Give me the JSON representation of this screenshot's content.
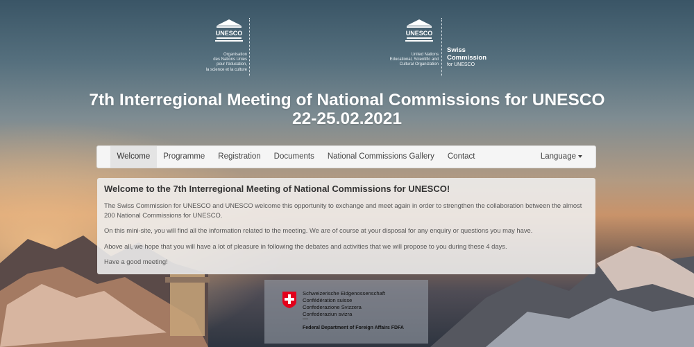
{
  "logos": {
    "unesco_wordmark": "UNESCO",
    "org_fr": "Organisation\ndes Nations Unies\npour l'éducation,\nla science et la culture",
    "org_en": "United Nations\nEducational, Scientific and\nCultural Organization",
    "swiss_commission": "Swiss\nCommission",
    "for_unesco": "for UNESCO"
  },
  "page": {
    "title": "7th Interregional Meeting of National Commissions for UNESCO\n22-25.02.2021"
  },
  "nav": {
    "items": [
      {
        "label": "Welcome",
        "active": true
      },
      {
        "label": "Programme",
        "active": false
      },
      {
        "label": "Registration",
        "active": false
      },
      {
        "label": "Documents",
        "active": false
      },
      {
        "label": "National Commissions Gallery",
        "active": false
      },
      {
        "label": "Contact",
        "active": false
      }
    ],
    "language": "Language"
  },
  "welcome": {
    "heading": "Welcome to the 7th Interregional Meeting of National Commissions for UNESCO!",
    "paragraphs": [
      "The Swiss Commission for UNESCO and UNESCO welcome this opportunity to exchange and meet again in order to strengthen the collaboration between the almost 200 National Commissions for UNESCO.",
      "On this mini-site, you will find all the information related to the meeting. We are of course at your disposal for any enquiry or questions you may have.",
      "Above all, we hope that you will have a lot of pleasure in following the debates and activities that we will propose to you during these 4 days.",
      "Have a good meeting!"
    ]
  },
  "footer": {
    "confederation": "Schweizerische Eidgenossenschaft\nConfédération suisse\nConfederazione Svizzera\nConfederaziun svizra",
    "department": "Federal Department of Foreign Affairs FDFA"
  },
  "colors": {
    "sky_top": "#3a5566",
    "sunset": "#c9936a",
    "navbar_bg": "#f5f5f5",
    "panel_bg": "#efefef",
    "swiss_red": "#e3001b"
  }
}
